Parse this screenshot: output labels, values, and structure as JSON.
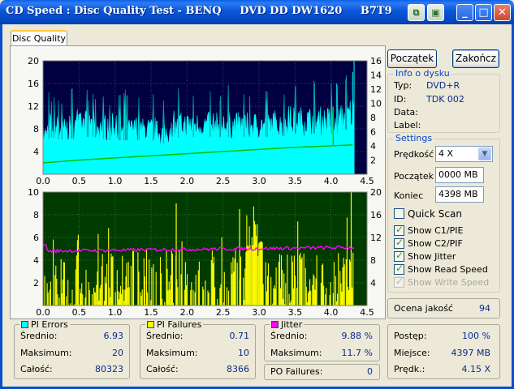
{
  "window": {
    "title": "CD Speed : Disc Quality Test - BENQ     DVD DD DW1620     B7T9"
  },
  "tab": {
    "label": "Disc Quality"
  },
  "buttons": {
    "start": "Początek",
    "close": "Zakończ"
  },
  "info": {
    "title": "Info o dysku",
    "rows": [
      {
        "label": "Typ:",
        "value": "DVD+R"
      },
      {
        "label": "ID:",
        "value": "TDK 002"
      },
      {
        "label": "Data:",
        "value": ""
      },
      {
        "label": "Label:",
        "value": ""
      }
    ]
  },
  "settings": {
    "title": "Settings",
    "speed_label": "Prędkość",
    "speed_value": "4 X",
    "start_label": "Początek",
    "start_value": "0000 MB",
    "end_label": "Koniec",
    "end_value": "4398 MB",
    "quick_scan": "Quick Scan",
    "show_c1": "Show C1/PIE",
    "show_c2": "Show C2/PIF",
    "show_jitter": "Show Jitter",
    "show_read": "Show Read Speed",
    "show_write": "Show Write Speed"
  },
  "quality": {
    "label": "Ocena jakość",
    "value": "94"
  },
  "progress": {
    "rows": [
      {
        "label": "Postęp:",
        "value": "100 %"
      },
      {
        "label": "Miejsce:",
        "value": "4397 MB"
      },
      {
        "label": "Prędk.:",
        "value": "4.15 X"
      }
    ]
  },
  "pi_errors": {
    "title": "PI Errors",
    "rows": [
      {
        "label": "Średnio:",
        "value": "6.93"
      },
      {
        "label": "Maksimum:",
        "value": "20"
      },
      {
        "label": "Całość:",
        "value": "80323"
      }
    ]
  },
  "pi_failures": {
    "title": "PI Failures",
    "rows": [
      {
        "label": "Średnio:",
        "value": "0.71"
      },
      {
        "label": "Maksimum:",
        "value": "10"
      },
      {
        "label": "Całość:",
        "value": "8366"
      }
    ]
  },
  "jitter": {
    "title": "Jitter",
    "rows": [
      {
        "label": "Średnio:",
        "value": "9.88 %"
      },
      {
        "label": "Maksimum:",
        "value": "11.7 %"
      }
    ]
  },
  "po_failures": {
    "label": "PO Failures:",
    "value": "0"
  },
  "colors": {
    "pie": "#00FFFF",
    "pif": "#FFFF00",
    "jitter": "#FF00FF",
    "speed": "#00C000",
    "upper_bg": "#000040",
    "lower_bg": "#003B00"
  },
  "chart_data": [
    {
      "type": "area",
      "name": "upper",
      "x_ticks": [
        "0.0",
        "0.5",
        "1.0",
        "1.5",
        "2.0",
        "2.5",
        "3.0",
        "3.5",
        "4.0",
        "4.5"
      ],
      "xlim": [
        0,
        4.5
      ],
      "ylim_left": [
        0,
        20
      ],
      "y_ticks_left": [
        "4",
        "8",
        "12",
        "16",
        "20"
      ],
      "ylim_right": [
        0,
        16
      ],
      "y_ticks_right": [
        "2",
        "4",
        "6",
        "8",
        "10",
        "12",
        "14",
        "16"
      ],
      "pie_envelope": [
        [
          0,
          8
        ],
        [
          0.1,
          11
        ],
        [
          0.3,
          10
        ],
        [
          0.5,
          11
        ],
        [
          0.7,
          11
        ],
        [
          0.9,
          10
        ],
        [
          1.1,
          10
        ],
        [
          1.3,
          10
        ],
        [
          1.5,
          10
        ],
        [
          1.7,
          9
        ],
        [
          1.9,
          11
        ],
        [
          2.1,
          11
        ],
        [
          2.3,
          11
        ],
        [
          2.5,
          11
        ],
        [
          2.7,
          11
        ],
        [
          2.9,
          11
        ],
        [
          3.1,
          11
        ],
        [
          3.3,
          11
        ],
        [
          3.5,
          12
        ],
        [
          3.7,
          12
        ],
        [
          3.9,
          12
        ],
        [
          4.1,
          12
        ],
        [
          4.2,
          13
        ],
        [
          4.3,
          14
        ]
      ],
      "read_speed": [
        [
          0,
          1.6
        ],
        [
          0.5,
          2.0
        ],
        [
          1.0,
          2.3
        ],
        [
          1.5,
          2.6
        ],
        [
          2.0,
          2.9
        ],
        [
          2.5,
          3.2
        ],
        [
          3.0,
          3.5
        ],
        [
          3.5,
          3.8
        ],
        [
          4.0,
          4.0
        ],
        [
          4.3,
          4.15
        ]
      ]
    },
    {
      "type": "bar",
      "name": "lower",
      "x_ticks": [
        "0.0",
        "0.5",
        "1.0",
        "1.5",
        "2.0",
        "2.5",
        "3.0",
        "3.5",
        "4.0",
        "4.5"
      ],
      "xlim": [
        0,
        4.5
      ],
      "ylim_left": [
        0,
        10
      ],
      "y_ticks_left": [
        "2",
        "4",
        "6",
        "8",
        "10"
      ],
      "ylim_right": [
        0,
        20
      ],
      "y_ticks_right": [
        "4",
        "8",
        "12",
        "16",
        "20"
      ],
      "pif_peak": [
        [
          2.85,
          9
        ],
        [
          2.9,
          10
        ],
        [
          2.95,
          8
        ],
        [
          3.0,
          7
        ]
      ],
      "jitter_level": 9.9
    }
  ]
}
